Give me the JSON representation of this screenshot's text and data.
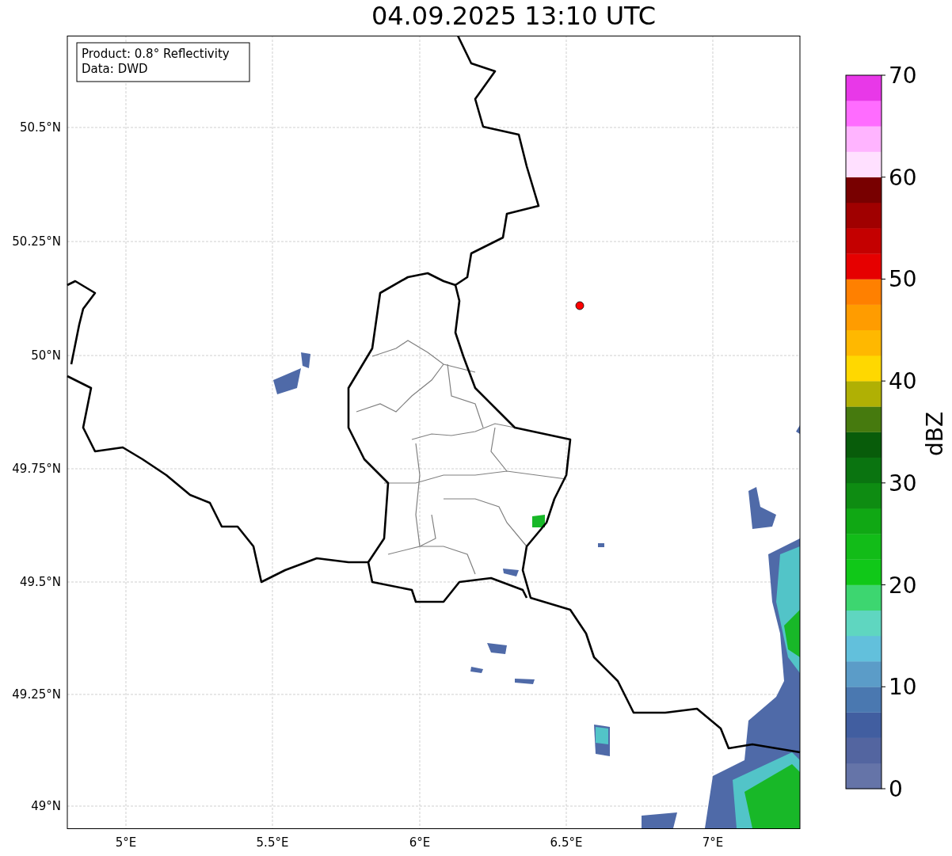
{
  "title": "04.09.2025 13:10 UTC",
  "legend": [
    "Product: 0.8° Reflectivity",
    "Data: DWD"
  ],
  "lat_labels": [
    "50.5°N",
    "50.25°N",
    "50°N",
    "49.75°N",
    "49.5°N",
    "49.25°N",
    "49°N"
  ],
  "lon_labels": [
    "5°E",
    "5.5°E",
    "6°E",
    "6.5°E",
    "7°E"
  ],
  "colorbar": {
    "label": "dBZ",
    "ticks": [
      "70",
      "60",
      "50",
      "40",
      "30",
      "20",
      "10",
      "0"
    ],
    "segments": [
      {
        "color": "#6574a8"
      },
      {
        "color": "#5365a0"
      },
      {
        "color": "#415ea0"
      },
      {
        "color": "#4a78b0"
      },
      {
        "color": "#5b9cc8"
      },
      {
        "color": "#62c0dc"
      },
      {
        "color": "#5fd6c0"
      },
      {
        "color": "#3dd670"
      },
      {
        "color": "#10c818"
      },
      {
        "color": "#12bc18"
      },
      {
        "color": "#10a814"
      },
      {
        "color": "#0e8c12"
      },
      {
        "color": "#0a7410"
      },
      {
        "color": "#085c0a"
      },
      {
        "color": "#467a0e"
      },
      {
        "color": "#b0b004"
      },
      {
        "color": "#ffd800"
      },
      {
        "color": "#ffb800"
      },
      {
        "color": "#ff9c00"
      },
      {
        "color": "#ff8000"
      },
      {
        "color": "#e60000"
      },
      {
        "color": "#c40000"
      },
      {
        "color": "#a00000"
      },
      {
        "color": "#780000"
      },
      {
        "color": "#ffe0ff"
      },
      {
        "color": "#ffb4ff"
      },
      {
        "color": "#ff6cff"
      },
      {
        "color": "#e838e8"
      }
    ]
  }
}
